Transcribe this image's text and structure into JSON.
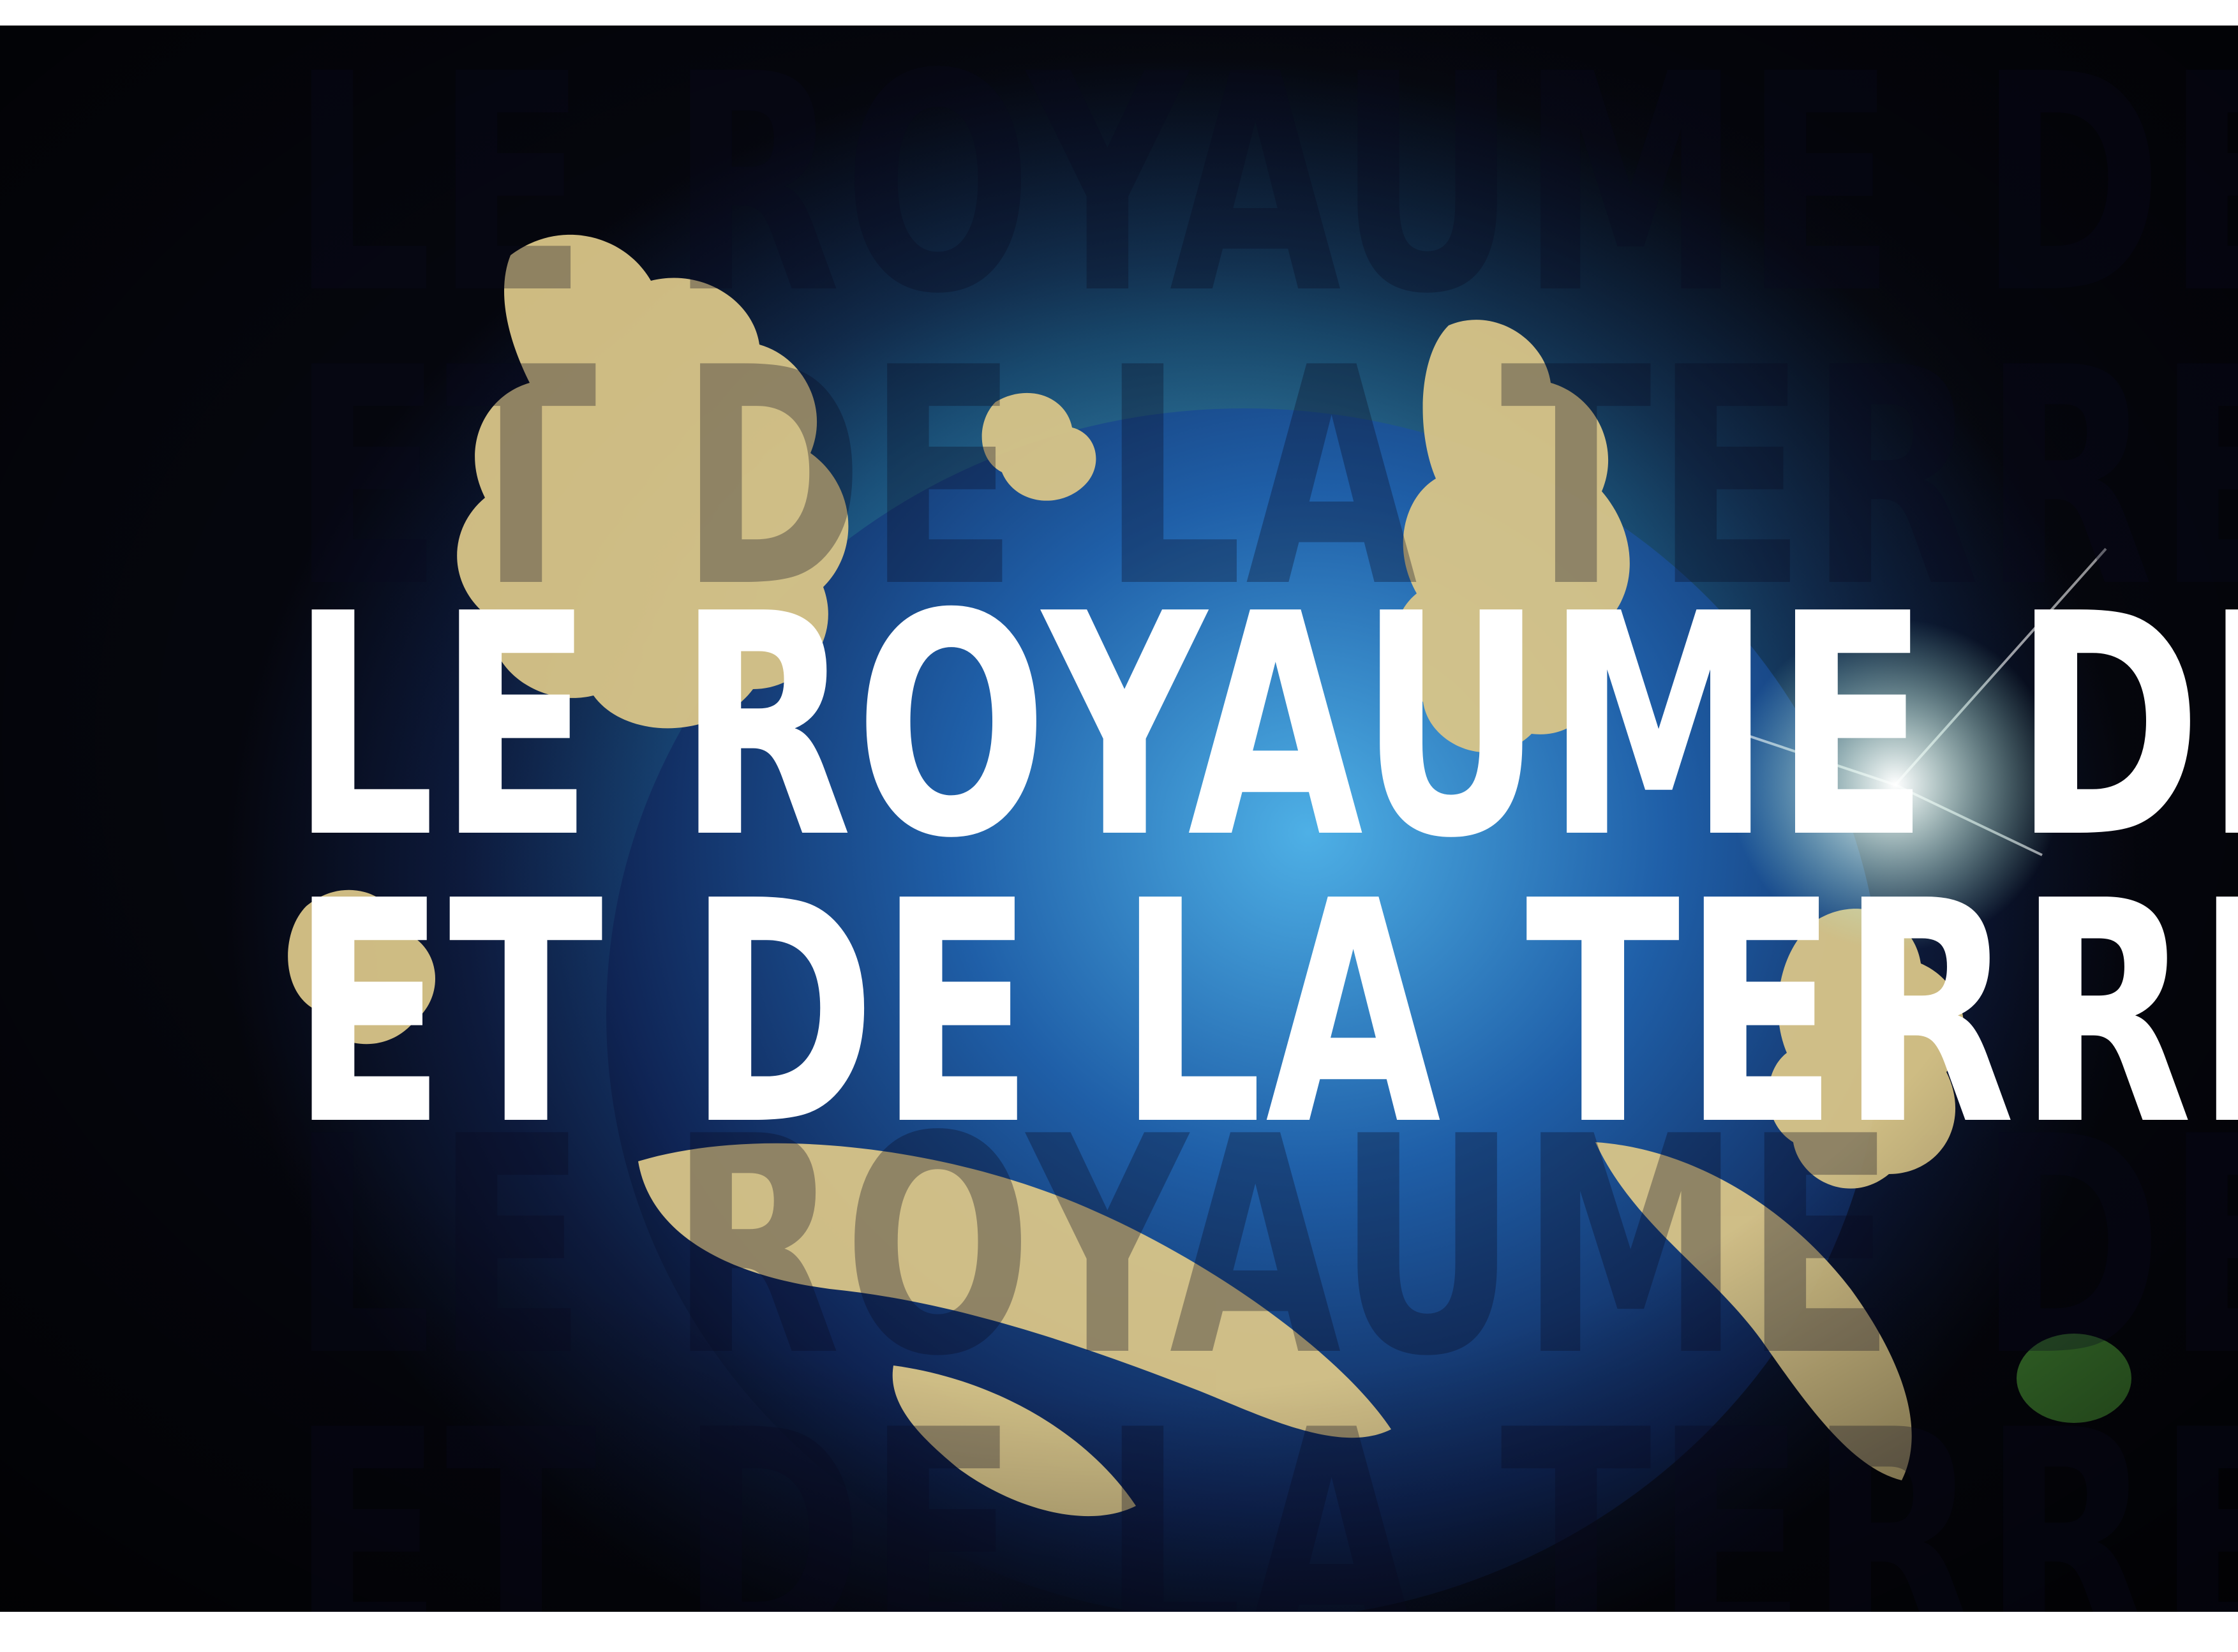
{
  "poster": {
    "title_line_1": "LE ROYAUME DES CIEUX",
    "title_line_2": "ET DE LA TERRE",
    "ghost_text": [
      "LE ROYAUME DES CIEUX",
      "ET DE LA TERRE",
      "LE ROYAUME DES CIEUX",
      "ET DE LA TERRE"
    ],
    "background_image": "earth-with-golden-clouds",
    "colors": {
      "space_dark": "#05060d",
      "ocean_blue": "#1f6f9c",
      "cloud_gold": "#d8c27a",
      "title_text": "#ffffff"
    }
  }
}
